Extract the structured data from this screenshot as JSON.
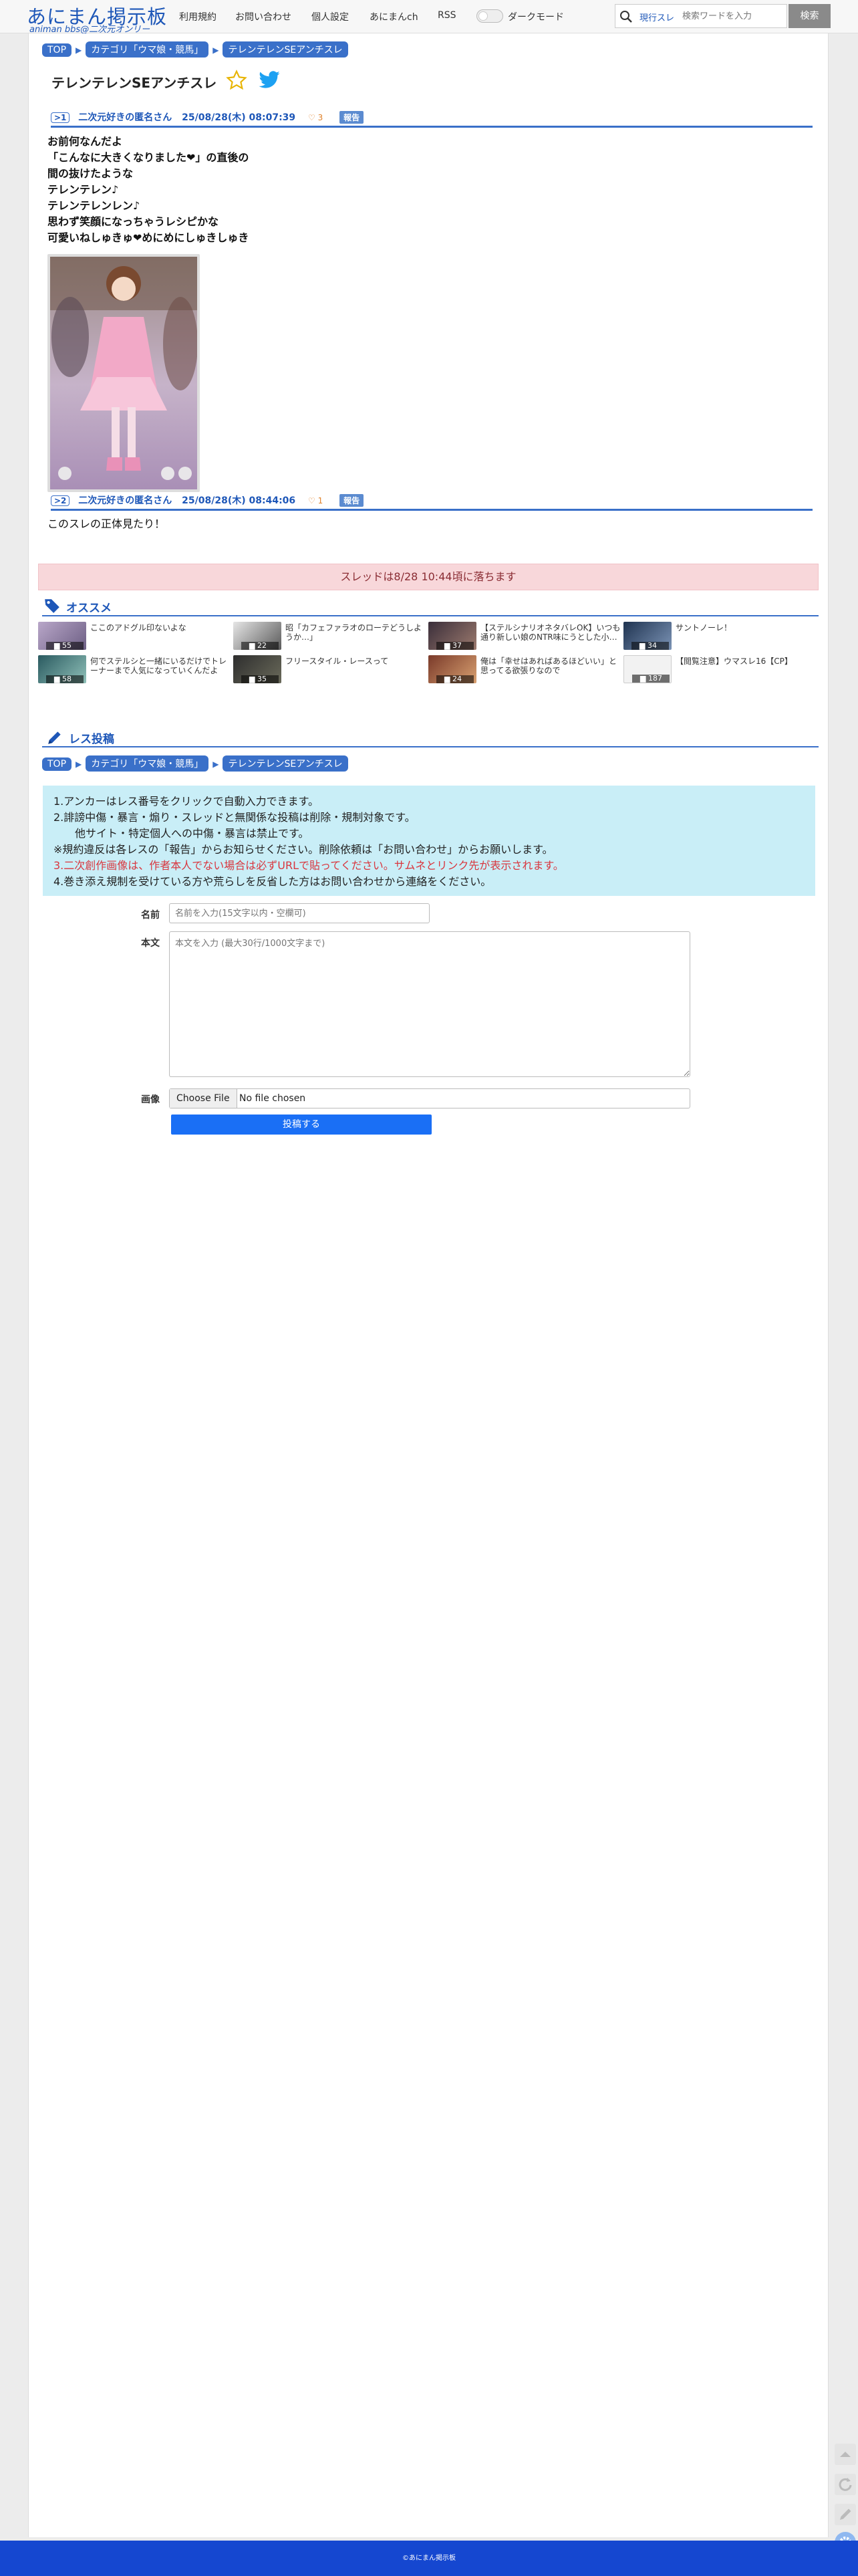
{
  "header": {
    "logo_title": "あにまん掲示板",
    "logo_subtitle": "animan bbs@二次元オンリー",
    "nav": [
      "利用規約",
      "お問い合わせ",
      "個人設定",
      "あにまんch",
      "RSS"
    ],
    "dark_mode_label": "ダークモード",
    "search_scope": "現行スレ",
    "search_placeholder": "検索ワードを入力",
    "search_button": "検索"
  },
  "breadcrumb": [
    "TOP",
    "カテゴリ「ウマ娘・競馬」",
    "テレンテレンSEアンチスレ"
  ],
  "thread_title": "テレンテレンSEアンチスレ",
  "posts": [
    {
      "num": ">1",
      "name": "二次元好きの匿名さん",
      "date": "25/08/28(木) 08:07:39",
      "likes": "3",
      "report": "報告",
      "lines": [
        "お前何なんだよ󠄀",
        "「こんなに大きくなりました❤」の直後の",
        "間の抜けたような",
        "テレンテレン♪",
        "テレンテレンレン♪",
        "思わず笑顔になっちゃうレシピかな󠄀",
        "可愛いね󠄀しゅきゅ❤めにめにしゅきしゅき"
      ]
    },
    {
      "num": ">2",
      "name": "二次元好きの匿名さん",
      "date": "25/08/28(木) 08:44:06",
      "likes": "1",
      "report": "報告",
      "lines": [
        "このスレの正体見たり！"
      ]
    }
  ],
  "drop_notice": "スレッドは8/28 10:44頃に落ちます",
  "recommend": {
    "title": "オススメ",
    "items": [
      {
        "count": "55",
        "text": "ここのアドグル印ないよな"
      },
      {
        "count": "22",
        "text": "昭「カフェファラオのローテどうしようか…」"
      },
      {
        "count": "37",
        "text": "【ステルシナリオネタバレOK】いつも通り新しい娘のNTR味にうとした小…"
      },
      {
        "count": "34",
        "text": "サントノーレ！"
      },
      {
        "count": "58",
        "text": "何でステルシと一緒にいるだけでトレーナーまで人気になっていくんだよ"
      },
      {
        "count": "35",
        "text": "フリースタイル・レースって"
      },
      {
        "count": "24",
        "text": "俺は「幸せはあればあるほどいい」と思ってる欲張りなので"
      },
      {
        "count": "187",
        "text": "【閲覧注意】ウマスレ16【CP】"
      }
    ]
  },
  "reply": {
    "title": "レス投稿",
    "notice_lines": [
      "1.アンカーはレス番号をクリックで自動入力できます。",
      "2.誹謗中傷・暴言・煽り・スレッドと無関係な投稿は削除・規制対象です。",
      "他サイト・特定個人への中傷・暴言は禁止です。",
      "※規約違反は各レスの「報告」からお知らせください。削除依頼は「お問い合わせ」からお願いします。",
      "3.二次創作画像は、作者本人でない場合は必ずURLで貼ってください。サムネとリンク先が表示されます。",
      "4.巻き添え規制を受けている方や荒らしを反省した方はお問い合わせから連絡をください。"
    ],
    "name_label": "名前",
    "name_placeholder": "名前を入力(15文字以内・空欄可)",
    "body_label": "本文",
    "body_placeholder": "本文を入力 (最大30行/1000文字まで)",
    "image_label": "画像",
    "file_button": "Choose File",
    "file_status": "No file chosen",
    "submit": "投稿する"
  },
  "footer": "©あにまん掲示板",
  "colors": {
    "brand": "#1e57b8",
    "accent": "#3a70c9",
    "notice_bg": "#c9eef7",
    "drop_bg": "#f8d7da",
    "warn": "#d9363e",
    "submit": "#1a6ff5"
  }
}
